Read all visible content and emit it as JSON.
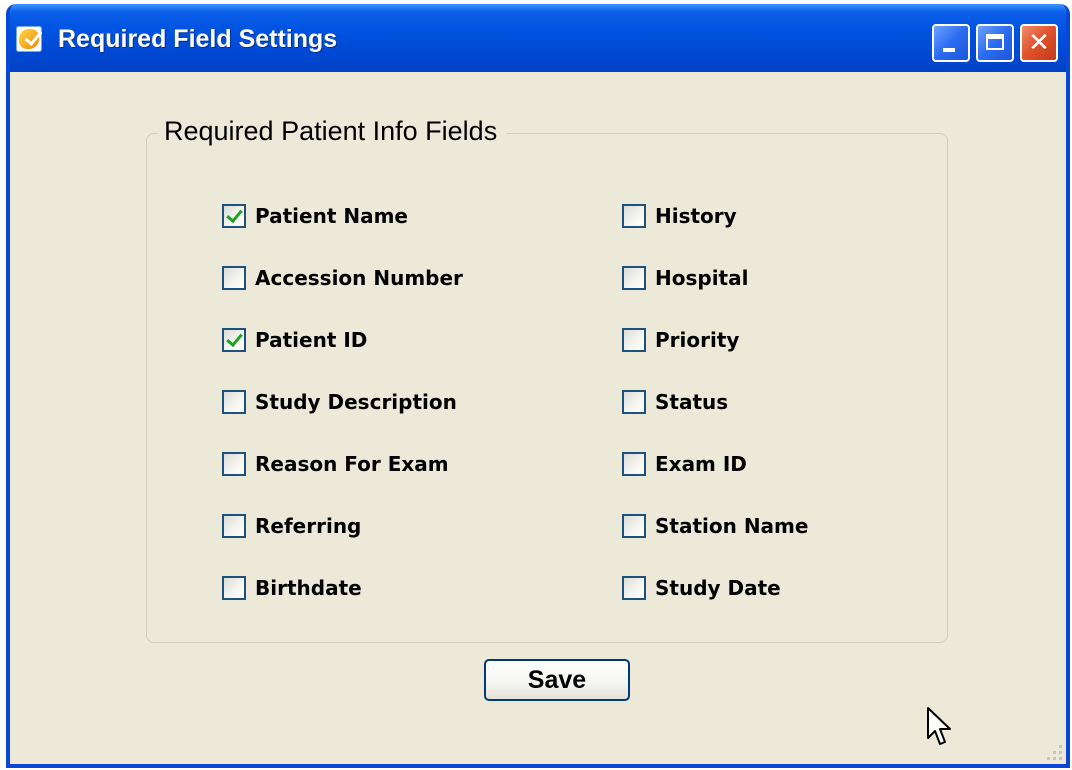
{
  "window": {
    "title": "Required Field Settings",
    "title_icon": "app-hand-icon",
    "controls": {
      "minimize_icon": "minimize-icon",
      "maximize_icon": "maximize-icon",
      "close_icon": "close-icon",
      "close_glyph": "✕"
    }
  },
  "group": {
    "legend": "Required Patient Info Fields",
    "left_column": [
      {
        "label": "Patient Name",
        "checked": true
      },
      {
        "label": "Accession Number",
        "checked": false
      },
      {
        "label": "Patient ID",
        "checked": true
      },
      {
        "label": "Study Description",
        "checked": false
      },
      {
        "label": "Reason For Exam",
        "checked": false
      },
      {
        "label": "Referring",
        "checked": false
      },
      {
        "label": "Birthdate",
        "checked": false
      }
    ],
    "right_column": [
      {
        "label": "History",
        "checked": false
      },
      {
        "label": "Hospital",
        "checked": false
      },
      {
        "label": "Priority",
        "checked": false
      },
      {
        "label": "Status",
        "checked": false
      },
      {
        "label": "Exam ID",
        "checked": false
      },
      {
        "label": "Station Name",
        "checked": false
      },
      {
        "label": "Study Date",
        "checked": false
      }
    ]
  },
  "actions": {
    "save_label": "Save"
  },
  "colors": {
    "titlebar": "#0052e0",
    "window_bg": "#ece9d8",
    "checkbox_border": "#1c5180",
    "checkmark": "#21a121",
    "close_button": "#e0502a"
  }
}
